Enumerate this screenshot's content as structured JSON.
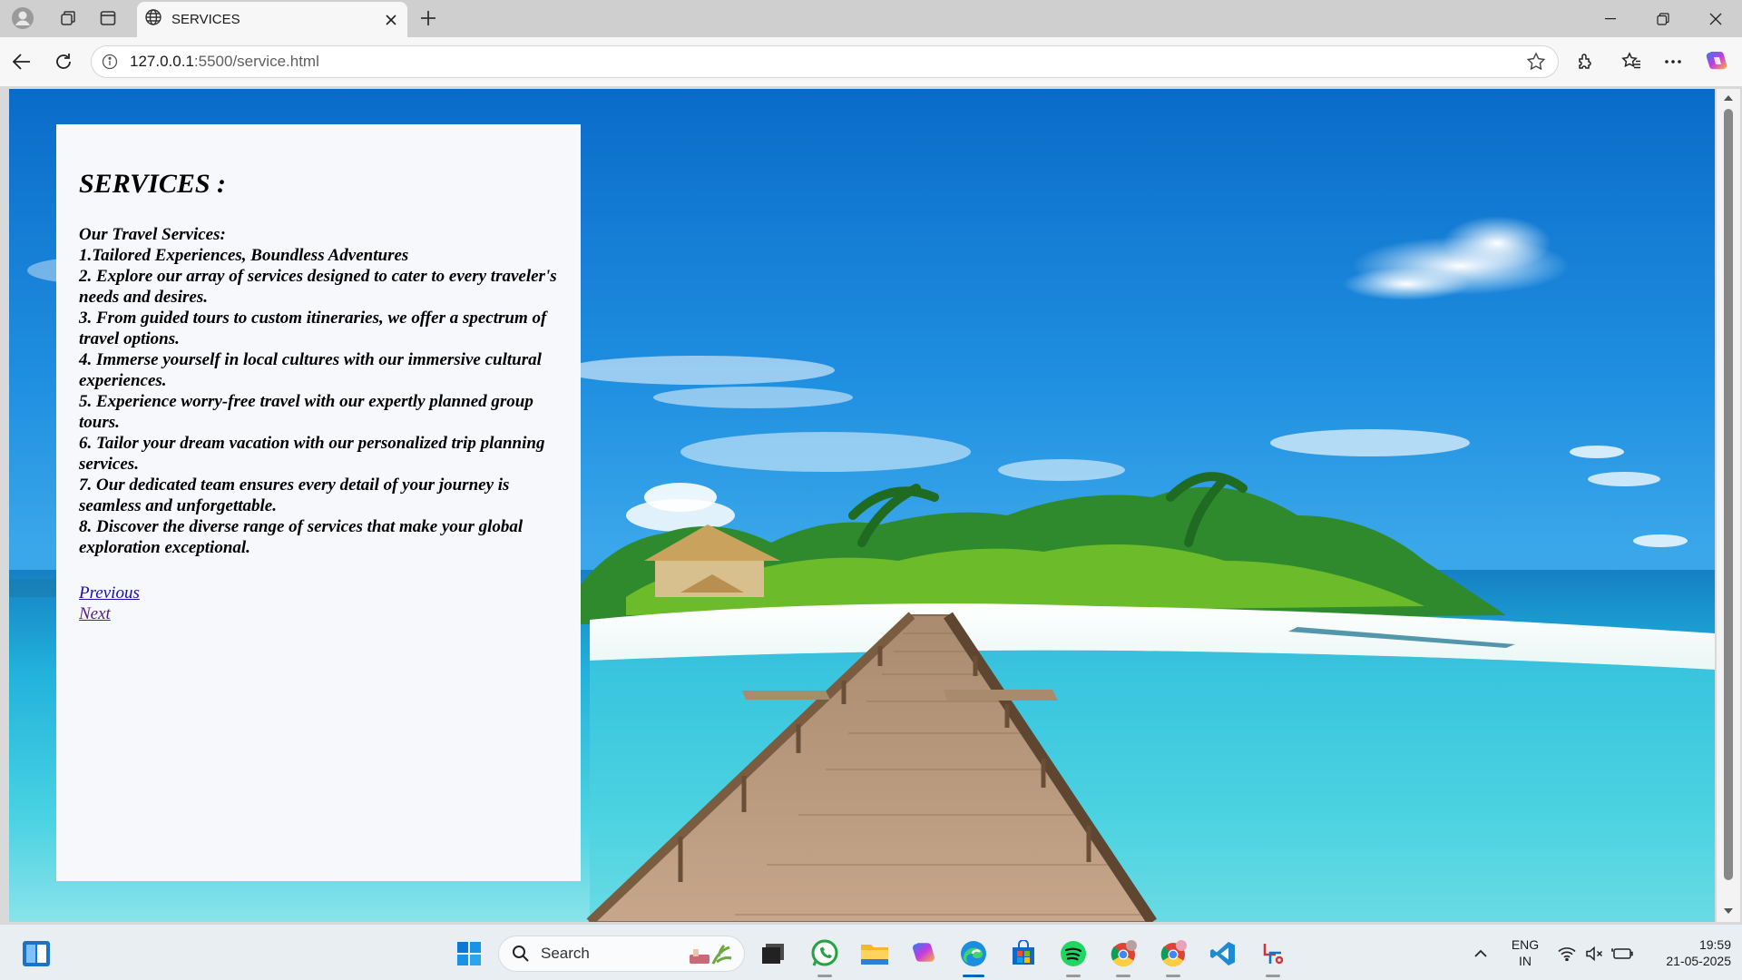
{
  "browser": {
    "tab": {
      "title": "SERVICES"
    },
    "address": {
      "host": "127.0.0.1",
      "path": ":5500/service.html"
    }
  },
  "page": {
    "heading": "SERVICES :",
    "subheading": "Our Travel Services:",
    "services": [
      "1.Tailored Experiences, Boundless Adventures",
      "2. Explore our array of services designed to cater to every traveler's needs and desires.",
      "3. From guided tours to custom itineraries, we offer a spectrum of travel options.",
      "4. Immerse yourself in local cultures with our immersive cultural experiences.",
      "5. Experience worry-free travel with our expertly planned group tours.",
      "6. Tailor your dream vacation with our personalized trip planning services.",
      "7. Our dedicated team ensures every detail of your journey is seamless and unforgettable.",
      "8. Discover the diverse range of services that make your global exploration exceptional."
    ],
    "links": {
      "previous": "Previous",
      "next": "Next"
    }
  },
  "taskbar": {
    "search_label": "Search",
    "language": {
      "line1": "ENG",
      "line2": "IN"
    },
    "clock": {
      "time": "19:59",
      "date": "21-05-2025"
    }
  },
  "colors": {
    "link": "#1a0dab",
    "visited": "#551a8b",
    "panel": "#f7f8fc",
    "sea": "#1da6d8"
  }
}
